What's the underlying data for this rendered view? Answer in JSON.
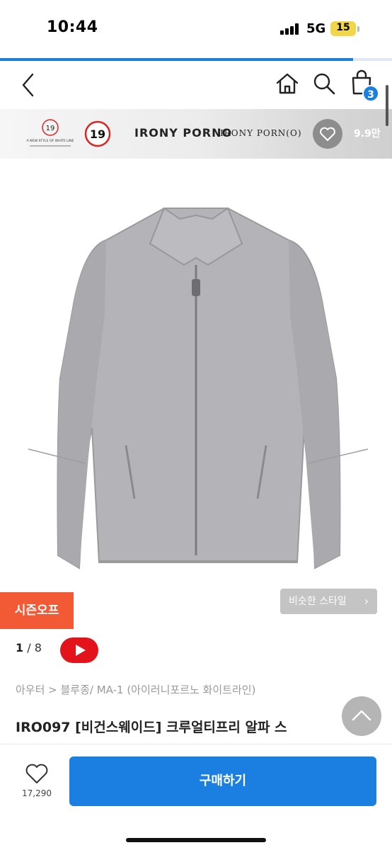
{
  "status_bar": {
    "time": "10:44",
    "network": "5G",
    "battery": "15"
  },
  "page_load_progress": 0.9,
  "nav": {
    "back_icon": "chevron-left-icon",
    "home_icon": "home-icon",
    "search_icon": "search-icon",
    "cart_icon": "shopping-bag-icon",
    "cart_count": "3"
  },
  "brand_banner": {
    "wordmark": "IRONY PORNO",
    "brand_name": "IRONY PORN(O)",
    "like_count": "9.9만",
    "small_logo": "19",
    "small_logo_text": "A NEW STYLE OF WHITE LINE"
  },
  "product": {
    "badge": "시즌오프",
    "similar_style": "비슷한 스타일",
    "image_current": "1",
    "image_total": "/ 8",
    "breadcrumb": "아우터 > 블루종/ MA-1 (아이러니포르노 화이트라인)",
    "title": "IRO097 [비건스웨이드] 크루얼티프리 알파 스"
  },
  "bottom_bar": {
    "wish_count": "17,290",
    "buy_label": "구매하기"
  },
  "colors": {
    "accent": "#1a7fe0",
    "badge": "#f25a35",
    "video": "#e3131b"
  }
}
